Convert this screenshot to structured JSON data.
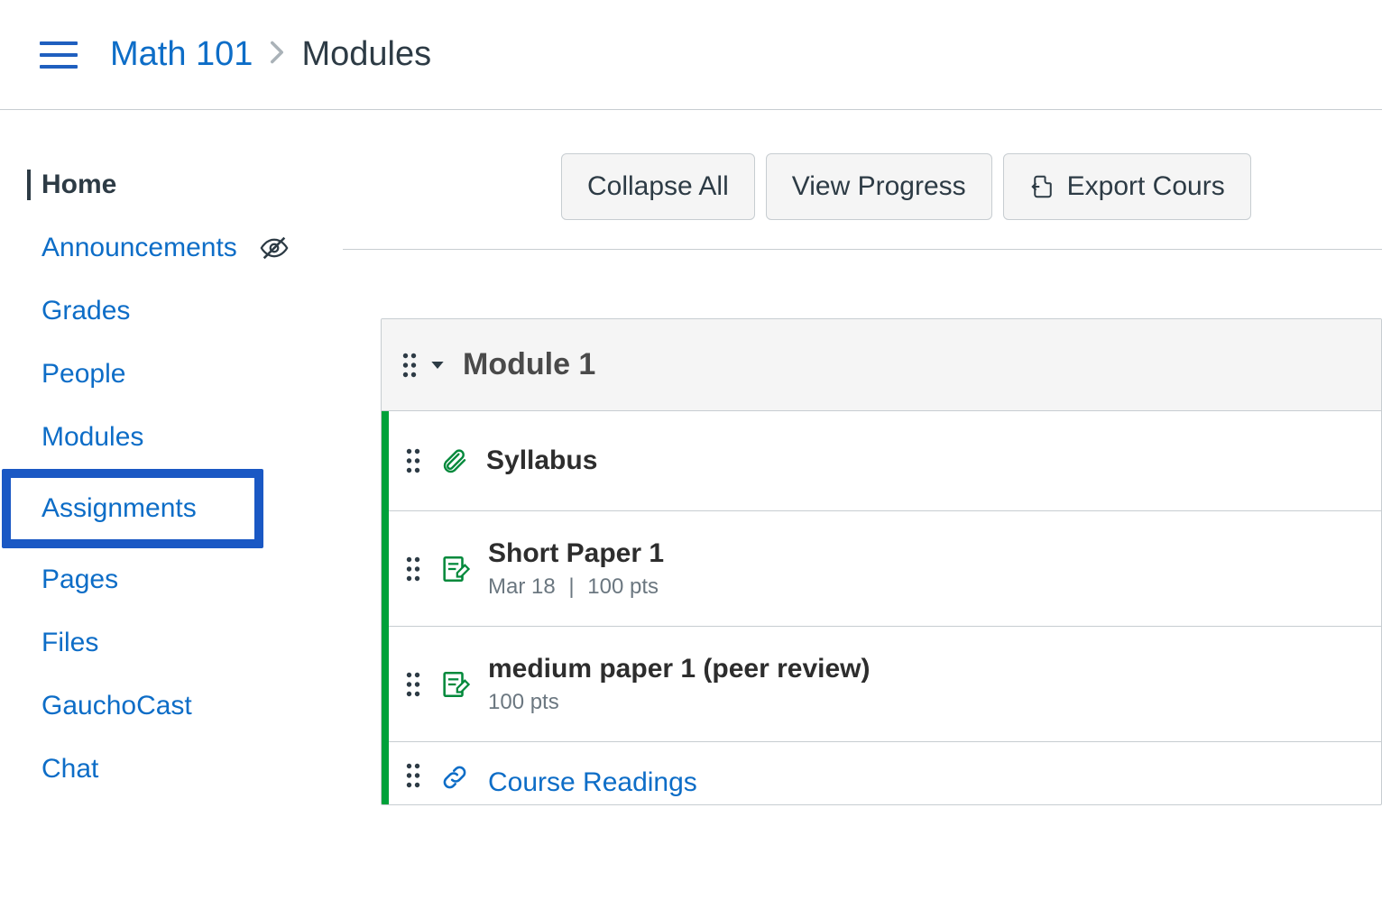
{
  "breadcrumb": {
    "course": "Math 101",
    "current": "Modules"
  },
  "sidebar": {
    "items": [
      {
        "label": "Home",
        "active": true,
        "hidden_eye": false
      },
      {
        "label": "Announcements",
        "active": false,
        "hidden_eye": true
      },
      {
        "label": "Grades",
        "active": false,
        "hidden_eye": false
      },
      {
        "label": "People",
        "active": false,
        "hidden_eye": false
      },
      {
        "label": "Modules",
        "active": false,
        "hidden_eye": false
      },
      {
        "label": "Assignments",
        "active": false,
        "hidden_eye": false,
        "highlight": true
      },
      {
        "label": "Pages",
        "active": false,
        "hidden_eye": false
      },
      {
        "label": "Files",
        "active": false,
        "hidden_eye": false
      },
      {
        "label": "GauchoCast",
        "active": false,
        "hidden_eye": false
      },
      {
        "label": "Chat",
        "active": false,
        "hidden_eye": false
      }
    ]
  },
  "toolbar": {
    "collapse": "Collapse All",
    "progress": "View Progress",
    "export": "Export Cours"
  },
  "module": {
    "title": "Module 1",
    "items": [
      {
        "kind": "file",
        "title": "Syllabus",
        "meta": ""
      },
      {
        "kind": "assignment",
        "title": "Short Paper 1",
        "due": "Mar 18",
        "pts": "100 pts"
      },
      {
        "kind": "assignment",
        "title": "medium paper 1 (peer review)",
        "due": "",
        "pts": "100 pts"
      },
      {
        "kind": "link",
        "title": "Course Readings",
        "meta": ""
      }
    ]
  }
}
